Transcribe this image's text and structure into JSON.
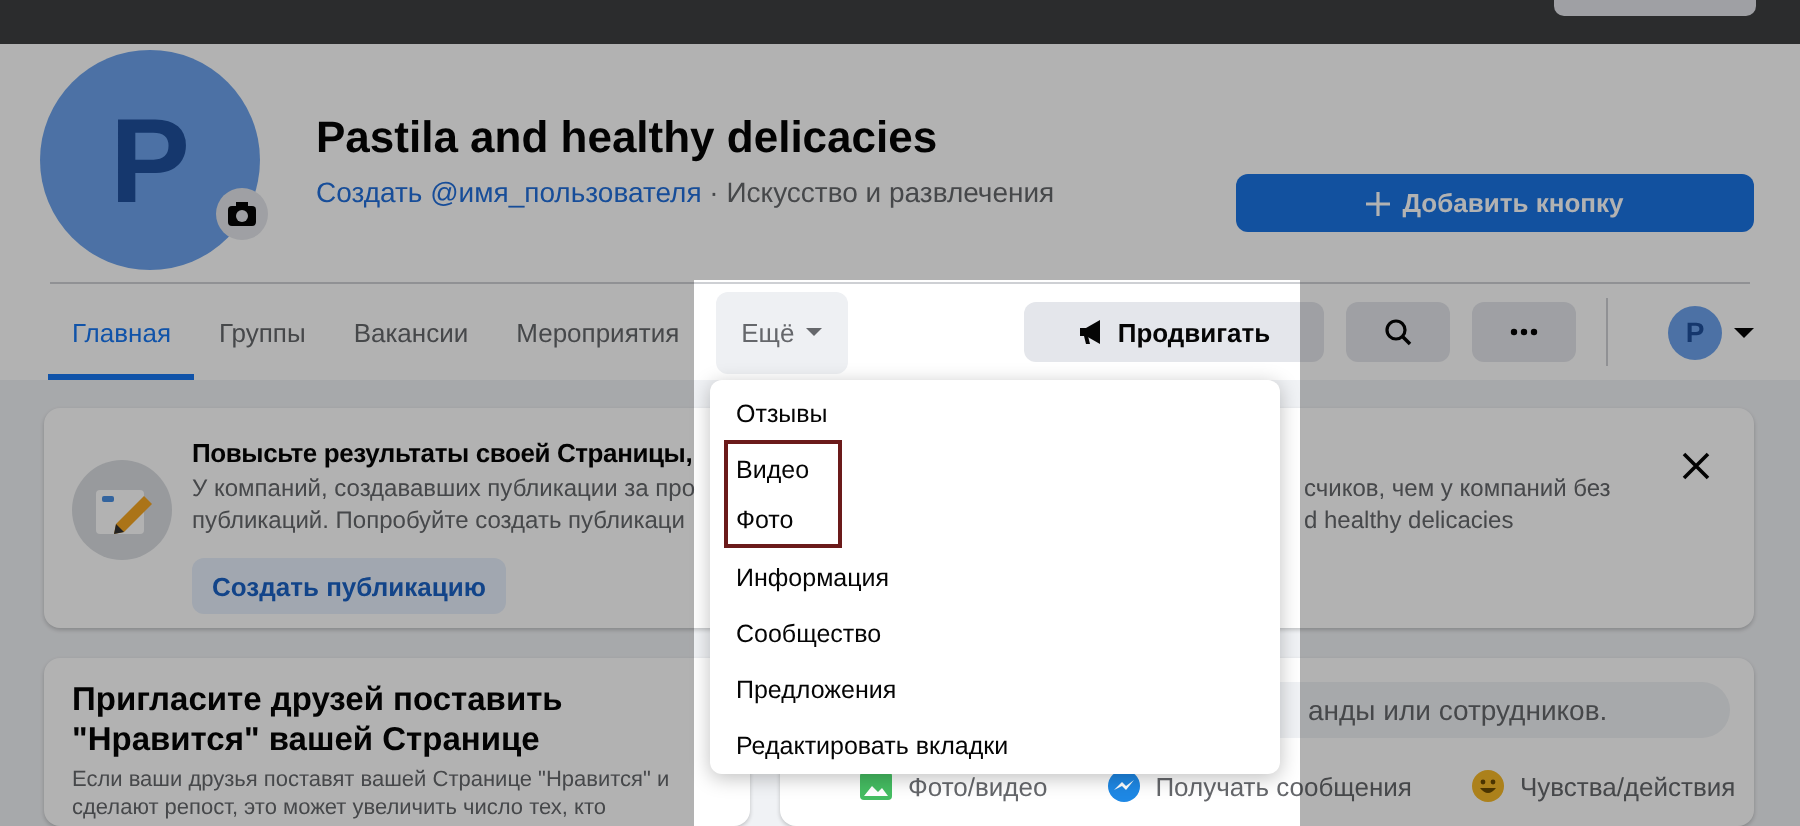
{
  "page": {
    "avatar_letter": "P",
    "name": "Pastila and healthy delicacies",
    "username_link": "Создать @имя_пользователя",
    "category": "· Искусство и развлечения",
    "add_button": "Добавить кнопку"
  },
  "tabs": [
    {
      "label": "Главная",
      "selected": true
    },
    {
      "label": "Группы",
      "selected": false
    },
    {
      "label": "Вакансии",
      "selected": false
    },
    {
      "label": "Мероприятия",
      "selected": false
    }
  ],
  "more_tab": {
    "label": "Ещё",
    "expanded": true
  },
  "actions": {
    "promote": "Продвигать",
    "profile_letter": "P"
  },
  "menu": {
    "items": [
      {
        "label": "Отзывы",
        "boxed": false
      },
      {
        "label": "Видео",
        "boxed": true
      },
      {
        "label": "Фото",
        "boxed": true
      },
      {
        "label": "Информация",
        "boxed": false
      },
      {
        "label": "Сообщество",
        "boxed": false
      },
      {
        "label": "Предложения",
        "boxed": false
      },
      {
        "label": "Редактировать вкладки",
        "boxed": false
      }
    ]
  },
  "tip_card": {
    "title": "Повысьте результаты своей Страницы,",
    "lines_left": [
      "У компаний, создававших публикации за про",
      "публикаций. Попробуйте создать публикаци"
    ],
    "lines_right": [
      "счиков, чем у компаний без",
      "d healthy delicacies"
    ],
    "button": "Создать публикацию"
  },
  "invite_card": {
    "title": "Пригласите друзей поставить \"Нравится\" вашей Странице",
    "text": "Если ваши друзья поставят вашей Странице \"Нравится\" и сделают репост, это может увеличить число тех, кто"
  },
  "composer": {
    "placeholder": "анды или сотрудников.",
    "actions": [
      {
        "label": "Фото/видео",
        "kind": "photo"
      },
      {
        "label": "Получать сообщения",
        "kind": "messenger"
      },
      {
        "label": "Чувства/действия",
        "kind": "feeling"
      }
    ]
  }
}
